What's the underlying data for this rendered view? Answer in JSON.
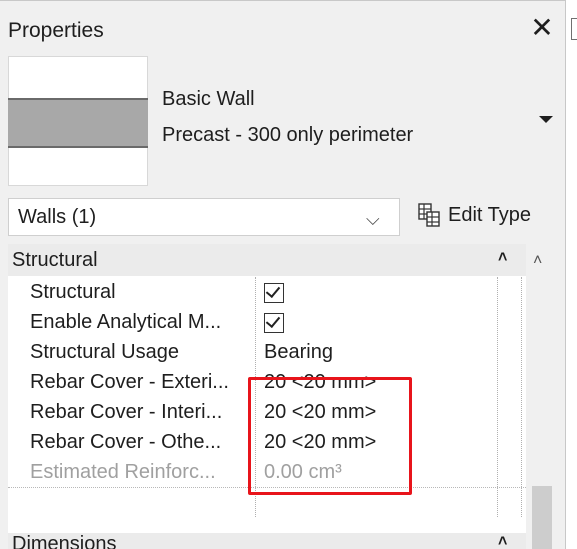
{
  "panel": {
    "title": "Properties",
    "close_glyph": "✕"
  },
  "type_selector": {
    "family": "Basic Wall",
    "type": "Precast - 300 only perimeter"
  },
  "filter": {
    "label": "Walls (1)",
    "chevron": "⌵",
    "edit_type_label": "Edit Type"
  },
  "groups": [
    {
      "label": "Structural",
      "collapse_glyph": "˄"
    },
    {
      "label": "Dimensions",
      "collapse_glyph": "˄"
    }
  ],
  "rows": [
    {
      "name": "Structural",
      "value": "",
      "checked": true
    },
    {
      "name": "Enable Analytical M...",
      "value": "",
      "checked": true
    },
    {
      "name": "Structural Usage",
      "value": "Bearing"
    },
    {
      "name": "Rebar Cover - Exteri...",
      "value": "20 <20 mm>"
    },
    {
      "name": "Rebar Cover - Interi...",
      "value": "20 <20 mm>"
    },
    {
      "name": "Rebar Cover - Othe...",
      "value": "20 <20 mm>"
    },
    {
      "name": "Estimated Reinforc...",
      "value": "0.00 cm³",
      "disabled": true
    }
  ],
  "scroll": {
    "up_glyph": "˄"
  },
  "colors": {
    "highlight": "#e8141b",
    "panel_bg": "#f0f0f0",
    "grid_bg": "#ffffff"
  },
  "icons": {
    "close": "close-icon",
    "dropdown": "chevron-down-icon",
    "edit_type": "edit-type-icon",
    "check": "checkbox-icon"
  }
}
